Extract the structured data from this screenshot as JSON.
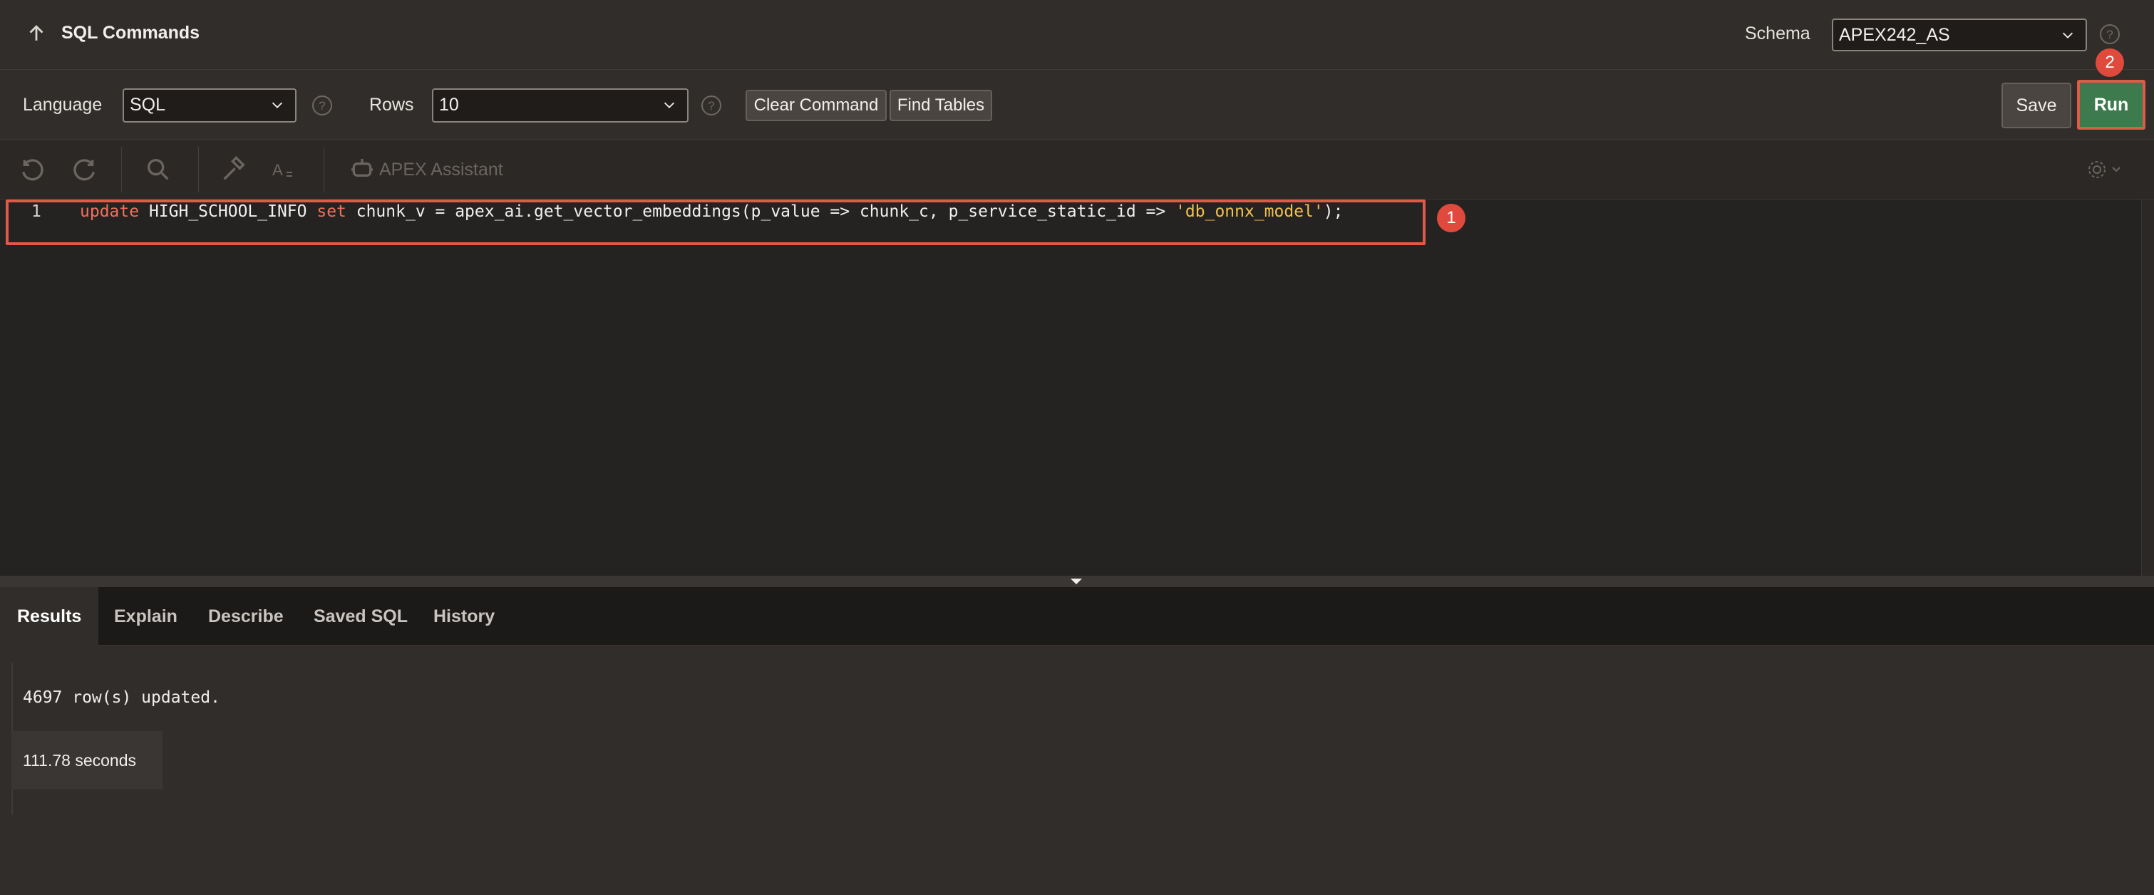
{
  "header": {
    "title": "SQL Commands",
    "schema_label": "Schema",
    "schema_value": "APEX242_AS"
  },
  "toolbar": {
    "language_label": "Language",
    "language_value": "SQL",
    "rows_label": "Rows",
    "rows_value": "10",
    "clear_label": "Clear Command",
    "find_label": "Find Tables",
    "save_label": "Save",
    "run_label": "Run"
  },
  "editor_toolbar": {
    "assistant_label": "APEX Assistant"
  },
  "editor": {
    "line_number": "1",
    "code": {
      "kw_update": "update",
      "seg1": " HIGH_SCHOOL_INFO ",
      "kw_set": "set",
      "seg2": " chunk_v = apex_ai.get_vector_embeddings(p_value => chunk_c, p_service_static_id => ",
      "str": "'db_onnx_model'",
      "seg3": ");"
    }
  },
  "callouts": {
    "one": "1",
    "two": "2"
  },
  "tabs": [
    "Results",
    "Explain",
    "Describe",
    "Saved SQL",
    "History"
  ],
  "results": {
    "message": "4697 row(s) updated.",
    "elapsed": "111.78 seconds"
  },
  "colors": {
    "run_button": "#3d7a4e",
    "callout": "#e04a3c",
    "keyword": "#f0705a",
    "string": "#f2c14e"
  }
}
